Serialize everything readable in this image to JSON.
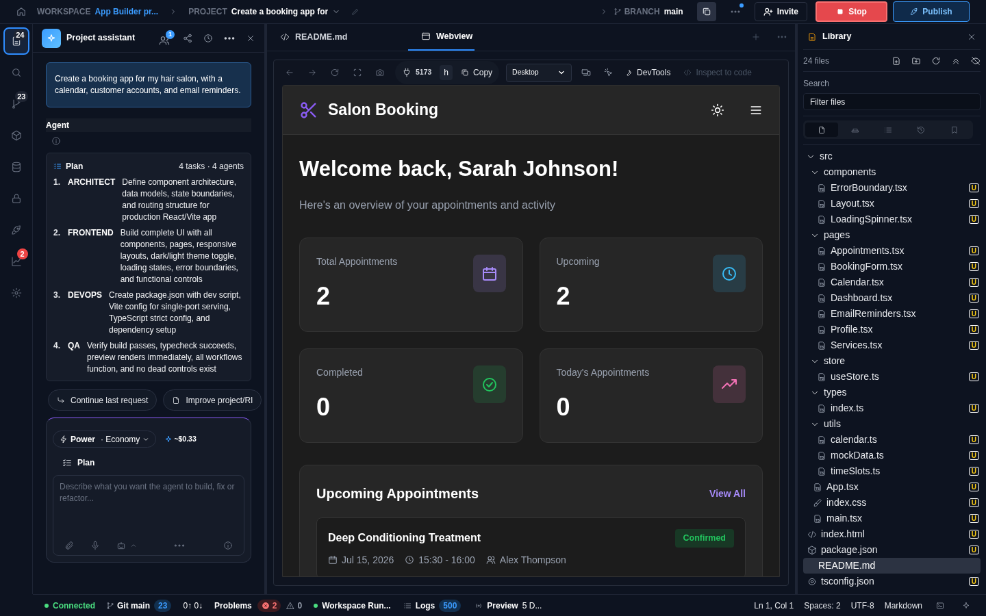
{
  "topbar": {
    "workspace_label": "WORKSPACE",
    "workspace": "App Builder pr...",
    "project_label": "PROJECT",
    "project": "Create a booking app for",
    "branch_label": "BRANCH",
    "branch": "main",
    "invite": "Invite",
    "stop": "Stop",
    "publish": "Publish"
  },
  "rail": [
    {
      "kind": "files",
      "badge": "24",
      "alert": false,
      "selected": true
    },
    {
      "kind": "search",
      "selected": false
    },
    {
      "kind": "git",
      "badge": "23",
      "alert": false,
      "selected": false
    },
    {
      "kind": "cube",
      "selected": false
    },
    {
      "kind": "database",
      "selected": false
    },
    {
      "kind": "lock",
      "selected": false
    },
    {
      "kind": "rocket",
      "selected": false
    },
    {
      "kind": "chart",
      "badge": "2",
      "alert": true,
      "selected": false
    },
    {
      "kind": "gear",
      "selected": false
    }
  ],
  "assistant": {
    "title": "Project assistant",
    "collab_count": "1",
    "prompt": "Create a booking app for my hair salon, with a calendar, customer accounts, and email reminders.",
    "agent_label": "Agent",
    "plan": {
      "title": "Plan",
      "summary": "4 tasks · 4 agents",
      "tasks": [
        {
          "number": "1.",
          "role": "ARCHITECT",
          "text": "Define component architecture, data models, state boundaries, and routing structure for production React/Vite app"
        },
        {
          "number": "2.",
          "role": "FRONTEND",
          "text": "Build complete UI with all components, pages, responsive layouts, dark/light theme toggle, loading states, error boundaries, and functional controls"
        },
        {
          "number": "3.",
          "role": "DEVOPS",
          "text": "Create package.json with dev script, Vite config for single-port serving, TypeScript strict config, and dependency setup"
        },
        {
          "number": "4.",
          "role": "QA",
          "text": "Verify build passes, typecheck succeeds, preview renders immediately, all workflows function, and no dead controls exist"
        }
      ]
    },
    "suggestions": [
      {
        "label": "Continue last request",
        "kind": "reply"
      },
      {
        "label": "Improve project/RI",
        "kind": "file"
      }
    ],
    "composer": {
      "mode": "Power",
      "tier": "· Economy",
      "cost": "~$0.33",
      "plan_label": "Plan",
      "placeholder": "Describe what you want the agent to build, fix or refactor..."
    }
  },
  "editor_tabs": [
    {
      "label": "README.md",
      "kind": "code",
      "selected": false
    },
    {
      "label": "Webview",
      "kind": "window",
      "selected": true
    }
  ],
  "webview_toolbar": {
    "port": "5173",
    "host": "h",
    "copy": "Copy",
    "device": "Desktop",
    "devtools": "DevTools",
    "inspect": "Inspect to code"
  },
  "app": {
    "brand": "Salon Booking",
    "greeting": "Welcome back, Sarah Johnson!",
    "subtitle": "Here's an overview of your appointments and activity",
    "stats": [
      {
        "label": "Total Appointments",
        "value": "2",
        "kind": "calendar",
        "color": "#a78bfa"
      },
      {
        "label": "Upcoming",
        "value": "2",
        "kind": "clock",
        "color": "#38bdf8"
      },
      {
        "label": "Completed",
        "value": "0",
        "kind": "check",
        "color": "#22c55e"
      },
      {
        "label": "Today's Appointments",
        "value": "0",
        "kind": "trend",
        "color": "#f472b6"
      }
    ],
    "upcoming": {
      "title": "Upcoming Appointments",
      "view_all": "View All",
      "appointments": [
        {
          "service": "Deep Conditioning Treatment",
          "status": "Confirmed",
          "date": "Jul 15, 2026",
          "time": "15:30 - 16:00",
          "stylist": "Alex Thompson"
        }
      ]
    }
  },
  "library": {
    "title": "Library",
    "count": "24 files",
    "search_label": "Search",
    "filter_placeholder": "Filter files",
    "view_tabs": [
      {
        "kind": "file",
        "selected": true
      },
      {
        "kind": "layers",
        "selected": false
      },
      {
        "kind": "list",
        "selected": false
      },
      {
        "kind": "history",
        "selected": false
      },
      {
        "kind": "bookmark",
        "selected": false
      }
    ],
    "tree": [
      {
        "name": "src",
        "kind": "folder",
        "expanded": true,
        "children": [
          {
            "name": "components",
            "kind": "folder",
            "expanded": true,
            "children": [
              {
                "name": "ErrorBoundary.tsx",
                "kind": "ts",
                "status": "U",
                "selected": false
              },
              {
                "name": "Layout.tsx",
                "kind": "ts",
                "status": "U",
                "selected": false
              },
              {
                "name": "LoadingSpinner.tsx",
                "kind": "ts",
                "status": "U",
                "selected": false
              }
            ]
          },
          {
            "name": "pages",
            "kind": "folder",
            "expanded": true,
            "children": [
              {
                "name": "Appointments.tsx",
                "kind": "ts",
                "status": "U",
                "selected": false
              },
              {
                "name": "BookingForm.tsx",
                "kind": "ts",
                "status": "U",
                "selected": false
              },
              {
                "name": "Calendar.tsx",
                "kind": "ts",
                "status": "U",
                "selected": false
              },
              {
                "name": "Dashboard.tsx",
                "kind": "ts",
                "status": "U",
                "selected": false
              },
              {
                "name": "EmailReminders.tsx",
                "kind": "ts",
                "status": "U",
                "selected": false
              },
              {
                "name": "Profile.tsx",
                "kind": "ts",
                "status": "U",
                "selected": false
              },
              {
                "name": "Services.tsx",
                "kind": "ts",
                "status": "U",
                "selected": false
              }
            ]
          },
          {
            "name": "store",
            "kind": "folder",
            "expanded": true,
            "children": [
              {
                "name": "useStore.ts",
                "kind": "ts",
                "status": "U",
                "selected": false
              }
            ]
          },
          {
            "name": "types",
            "kind": "folder",
            "expanded": true,
            "children": [
              {
                "name": "index.ts",
                "kind": "ts",
                "status": "U",
                "selected": false
              }
            ]
          },
          {
            "name": "utils",
            "kind": "folder",
            "expanded": true,
            "children": [
              {
                "name": "calendar.ts",
                "kind": "ts",
                "status": "U",
                "selected": false
              },
              {
                "name": "mockData.ts",
                "kind": "ts",
                "status": "U",
                "selected": false
              },
              {
                "name": "timeSlots.ts",
                "kind": "ts",
                "status": "U",
                "selected": false
              }
            ]
          },
          {
            "name": "App.tsx",
            "kind": "ts",
            "status": "U",
            "selected": false
          },
          {
            "name": "index.css",
            "kind": "css",
            "status": "U",
            "selected": false
          },
          {
            "name": "main.tsx",
            "kind": "ts",
            "status": "U",
            "selected": false
          }
        ]
      },
      {
        "name": "index.html",
        "kind": "html",
        "status": "U",
        "selected": false
      },
      {
        "name": "package.json",
        "kind": "package",
        "status": "U",
        "selected": false
      },
      {
        "name": "README.md",
        "kind": "md",
        "selected": true
      },
      {
        "name": "tsconfig.json",
        "kind": "config",
        "status": "U",
        "selected": false
      }
    ]
  },
  "status_bar": {
    "connection": "Connected",
    "git_label": "Git main",
    "git_count": "23",
    "sync": "0↑ 0↓",
    "problems_label": "Problems",
    "errors": "2",
    "warnings": "0",
    "workspace": "Workspace Run...",
    "logs_label": "Logs",
    "logs_count": "500",
    "preview": "Preview",
    "preview_extra": "5 D...",
    "position": "Ln 1, Col 1",
    "spaces": "Spaces: 2",
    "encoding": "UTF-8",
    "language": "Markdown"
  }
}
